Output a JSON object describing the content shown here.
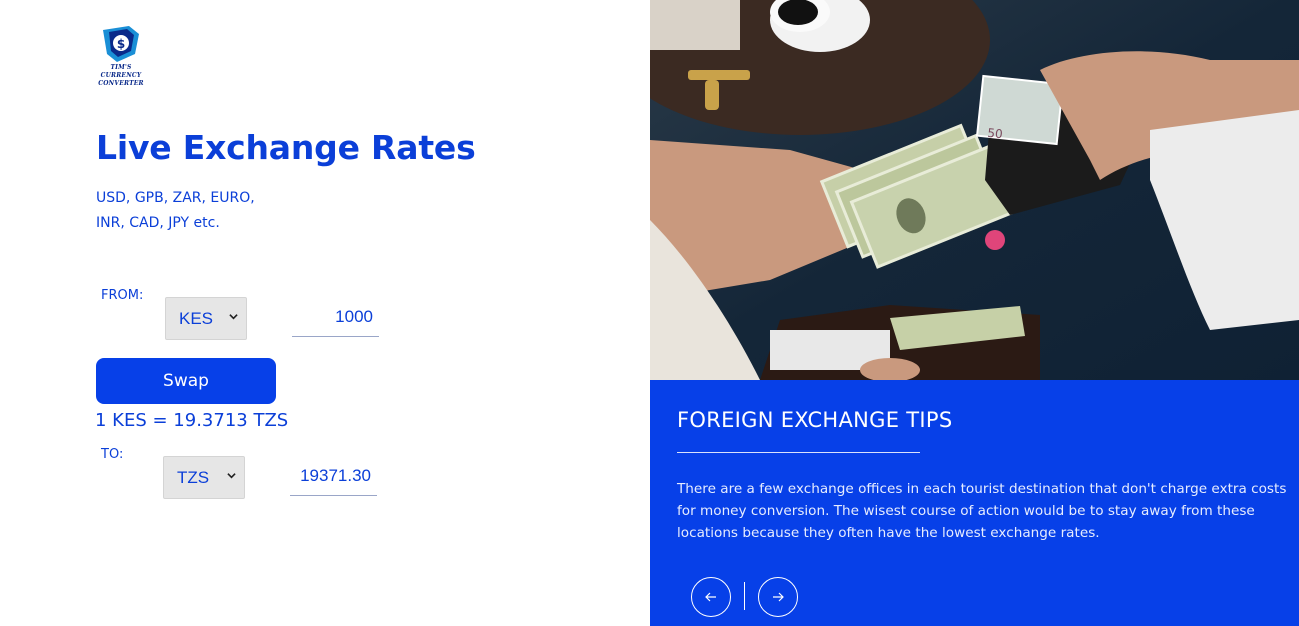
{
  "brand": {
    "logo_line1": "TIM'S",
    "logo_line2": "CURRENCY",
    "logo_line3": "CONVERTER"
  },
  "main": {
    "title": "Live Exchange Rates",
    "subtitle_line1": "USD, GPB, ZAR, EURO,",
    "subtitle_line2": "INR, CAD, JPY etc."
  },
  "converter": {
    "from_label": "FROM:",
    "from_currency": "KES",
    "from_amount": "1000",
    "swap_label": "Swap",
    "rate_text": "1 KES = 19.3713 TZS",
    "to_label": "TO:",
    "to_currency": "TZS",
    "to_amount": "19371.30"
  },
  "tips": {
    "title": "FOREIGN EXCHANGE TIPS",
    "body": "There are a few exchange offices in each tourist destination that don't charge extra costs for money conversion. The wisest course of action would be to stay away from these locations because they often have the lowest exchange rates."
  },
  "icons": {
    "prev": "arrow-left-icon",
    "next": "arrow-right-icon",
    "logo": "shield-dollar-icon"
  },
  "colors": {
    "accent": "#0740e8",
    "text": "#0b3fd8"
  }
}
